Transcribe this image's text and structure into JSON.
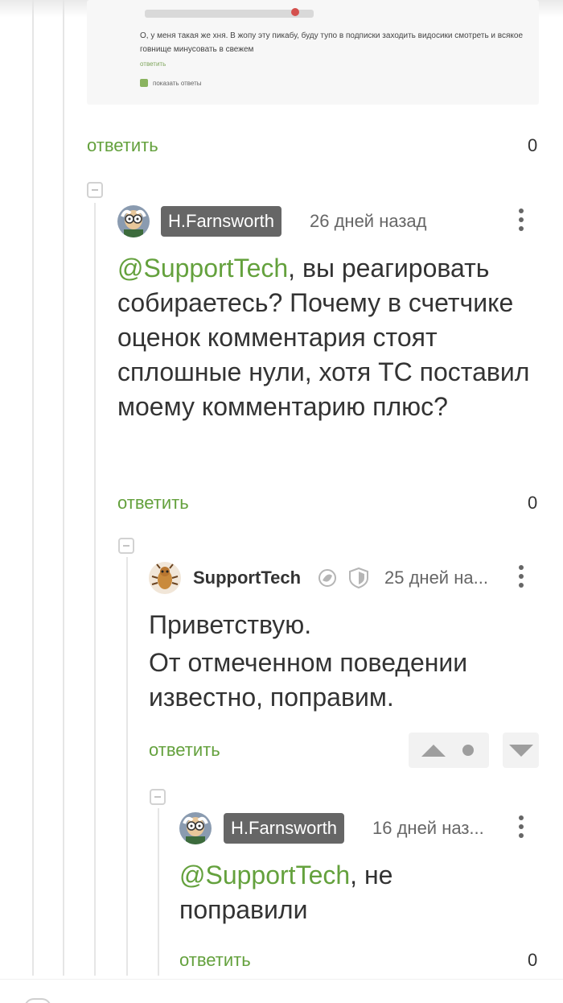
{
  "embedded": {
    "text": "О, у меня такая же хня. В жопу эту пикабу, буду тупо в подписки заходить видосики смотреть и всякое говнище минусовать в свежем",
    "reply_label": "ответить",
    "show_replies_label": "показать ответы"
  },
  "comment0_footer": {
    "reply_label": "ответить",
    "score": "0"
  },
  "comment1": {
    "author": "H.Farnsworth",
    "date": "26 дней назад",
    "mention": "@SupportTech",
    "text_rest": ", вы реагировать собираетесь? Почему в счетчике оценок комментария стоят сплошные нули, хотя ТС поставил моему комментарию плюс?",
    "reply_label": "ответить",
    "score": "0"
  },
  "comment2": {
    "author": "SupportTech",
    "date": "25 дней на...",
    "line1": "Приветствую.",
    "line2": "От отмеченном поведении известно, поправим.",
    "reply_label": "ответить"
  },
  "comment3": {
    "author": "H.Farnsworth",
    "date": "16 дней наз...",
    "mention": "@SupportTech",
    "text_rest": ", не поправили",
    "reply_label": "ответить",
    "score": "0"
  },
  "colors": {
    "accent_green": "#64a13d",
    "badge_gray": "#666666",
    "thread_line": "#e6e6e6"
  }
}
